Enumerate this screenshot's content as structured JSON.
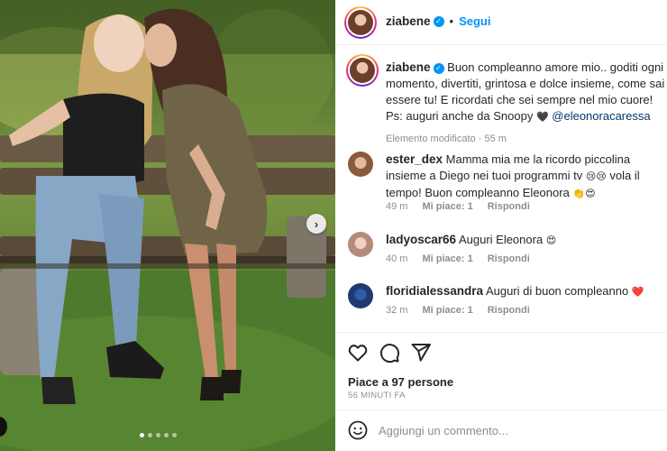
{
  "post": {
    "photo": {
      "alt_description": "",
      "carousel_dots": 5,
      "active_dot": 0
    },
    "header": {
      "username": "ziabene",
      "verified": true,
      "separator": "•",
      "follow_label": "Segui"
    },
    "caption": {
      "username": "ziabene",
      "text": " Buon compleanno amore mio.. goditi ogni momento, divertiti, grintosa e dolce insieme, come sai essere tu! E ricordati che sei sempre nel mio cuore! Ps: auguri anche da Snoopy ",
      "heart": "🖤",
      "mention": "@eleonoracaressa",
      "edited_label": "Elemento modificato",
      "time": "55 m"
    },
    "comments": [
      {
        "username": "ester_dex",
        "text": " Mamma mia me la ricordo piccolina insieme a Diego nei tuoi programmi tv ",
        "emoji_mid": "😢😢",
        "text2": " vola il tempo! Buon compleanno Eleonora ",
        "emoji_end": "👏😍",
        "time": "49 m",
        "likes": "Mi piace: 1",
        "reply": "Rispondi"
      },
      {
        "username": "ladyoscar66",
        "text": " Auguri Eleonora ",
        "emoji_end": "😍",
        "time": "40 m",
        "likes": "Mi piace: 1",
        "reply": "Rispondi"
      },
      {
        "username": "floridialessandra",
        "text": " Auguri di buon compleanno ",
        "emoji_end": "❤️",
        "time": "32 m",
        "likes": "Mi piace: 1",
        "reply": "Rispondi"
      }
    ],
    "likes": {
      "prefix": "Piace a ",
      "count": "97",
      "suffix": " persone"
    },
    "time_ago": "56 MINUTI FA",
    "comment_input": {
      "placeholder": "Aggiungi un commento..."
    },
    "colors": {
      "accent": "#0095f6",
      "heart_red": "#ed4956",
      "muted": "#8e8e8e"
    },
    "icons": [
      "heart-icon",
      "comment-icon",
      "share-icon",
      "emoji-icon",
      "verified-icon",
      "chevron-right-icon"
    ]
  }
}
